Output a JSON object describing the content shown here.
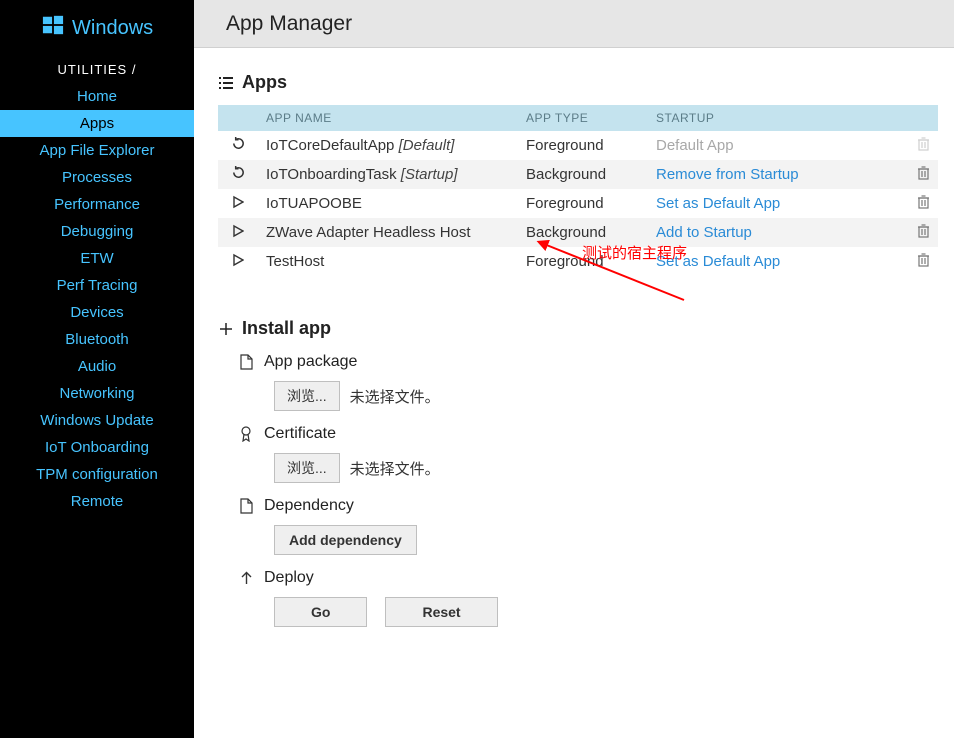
{
  "brand": "Windows",
  "breadcrumb": "UTILITIES /",
  "nav": [
    {
      "label": "Home",
      "active": false
    },
    {
      "label": "Apps",
      "active": true
    },
    {
      "label": "App File Explorer",
      "active": false
    },
    {
      "label": "Processes",
      "active": false
    },
    {
      "label": "Performance",
      "active": false
    },
    {
      "label": "Debugging",
      "active": false
    },
    {
      "label": "ETW",
      "active": false
    },
    {
      "label": "Perf Tracing",
      "active": false
    },
    {
      "label": "Devices",
      "active": false
    },
    {
      "label": "Bluetooth",
      "active": false
    },
    {
      "label": "Audio",
      "active": false
    },
    {
      "label": "Networking",
      "active": false
    },
    {
      "label": "Windows Update",
      "active": false
    },
    {
      "label": "IoT Onboarding",
      "active": false
    },
    {
      "label": "TPM configuration",
      "active": false
    },
    {
      "label": "Remote",
      "active": false
    }
  ],
  "page_title": "App Manager",
  "apps_section_title": "Apps",
  "cols": {
    "name": "APP NAME",
    "type": "APP TYPE",
    "startup": "STARTUP"
  },
  "rows": [
    {
      "icon": "restart",
      "name": "IoTCoreDefaultApp",
      "suffix": "[Default]",
      "type": "Foreground",
      "action": "Default App",
      "action_style": "disabled",
      "deletable": false
    },
    {
      "icon": "restart",
      "name": "IoTOnboardingTask",
      "suffix": "[Startup]",
      "type": "Background",
      "action": "Remove from Startup",
      "action_style": "link",
      "deletable": true
    },
    {
      "icon": "play",
      "name": "IoTUAPOOBE",
      "suffix": "",
      "type": "Foreground",
      "action": "Set as Default App",
      "action_style": "link",
      "deletable": true
    },
    {
      "icon": "play",
      "name": "ZWave Adapter Headless Host",
      "suffix": "",
      "type": "Background",
      "action": "Add to Startup",
      "action_style": "link",
      "deletable": true
    },
    {
      "icon": "play",
      "name": "TestHost",
      "suffix": "",
      "type": "Foreground",
      "action": "Set as Default App",
      "action_style": "link",
      "deletable": true
    }
  ],
  "install_section_title": "Install app",
  "app_package_label": "App package",
  "certificate_label": "Certificate",
  "dependency_label": "Dependency",
  "deploy_label": "Deploy",
  "browse_button": "浏览...",
  "no_file_text": "未选择文件。",
  "add_dependency_button": "Add dependency",
  "go_button": "Go",
  "reset_button": "Reset",
  "annotation_text": "测试的宿主程序"
}
